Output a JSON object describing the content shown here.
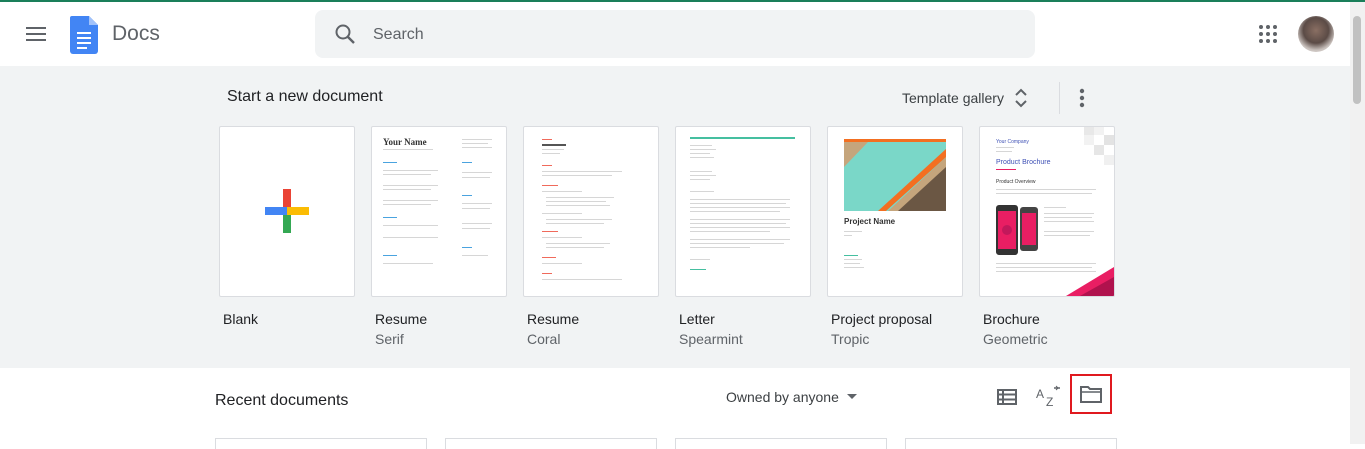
{
  "header": {
    "app_title": "Docs",
    "menu_icon": "hamburger-icon",
    "search": {
      "placeholder": "Search",
      "value": ""
    },
    "apps_icon": "apps-grid-icon",
    "avatar": "user-avatar"
  },
  "templates": {
    "heading": "Start a new document",
    "gallery_label": "Template gallery",
    "items": [
      {
        "name": "Blank",
        "sub": ""
      },
      {
        "name": "Resume",
        "sub": "Serif",
        "preview_title": "Your Name"
      },
      {
        "name": "Resume",
        "sub": "Coral"
      },
      {
        "name": "Letter",
        "sub": "Spearmint"
      },
      {
        "name": "Project proposal",
        "sub": "Tropic",
        "preview_title": "Project Name"
      },
      {
        "name": "Brochure",
        "sub": "Geometric",
        "preview_company": "Your Company",
        "preview_title": "Product Brochure",
        "preview_section": "Product Overview"
      }
    ]
  },
  "recent": {
    "heading": "Recent documents",
    "owner_filter": "Owned by anyone",
    "list_view_icon": "list-view-icon",
    "sort_icon": "sort-az-icon",
    "folder_icon": "folder-icon"
  },
  "colors": {
    "accent_line": "#1a7f5a",
    "docs_blue": "#4285f4",
    "highlight_red": "#e0191f"
  }
}
